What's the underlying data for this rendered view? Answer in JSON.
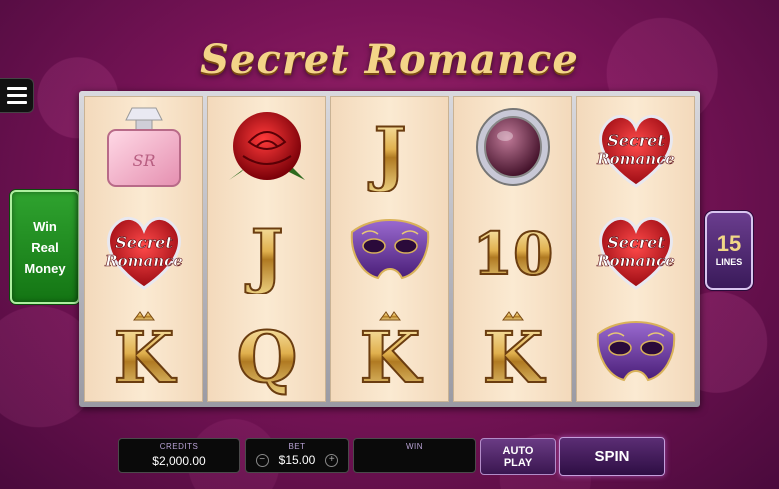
{
  "game": {
    "title": "Secret Romance"
  },
  "side": {
    "win_real_money": "Win\nReal\nMoney"
  },
  "lines": {
    "count": "15",
    "label": "LINES"
  },
  "reels": [
    [
      "perfume",
      "heart",
      "king"
    ],
    [
      "rose",
      "jack",
      "queen"
    ],
    [
      "jack",
      "mask",
      "king"
    ],
    [
      "ring",
      "ten",
      "king"
    ],
    [
      "heart",
      "heart",
      "mask"
    ]
  ],
  "symbol_text": {
    "jack": "J",
    "queen": "Q",
    "king": "K",
    "ten": "10",
    "heart_line1": "Secret",
    "heart_line2": "Romance"
  },
  "controls": {
    "credits_label": "CREDITS",
    "credits_value": "$2,000.00",
    "bet_label": "BET",
    "bet_value": "$15.00",
    "bet_minus": "−",
    "bet_plus": "+",
    "win_label": "WIN",
    "win_value": "",
    "autoplay_label": "AUTO\nPLAY",
    "spin_label": "SPIN"
  },
  "colors": {
    "gold": "#f1d787",
    "green": "#1d8c1d",
    "purple": "#5b2d74"
  }
}
